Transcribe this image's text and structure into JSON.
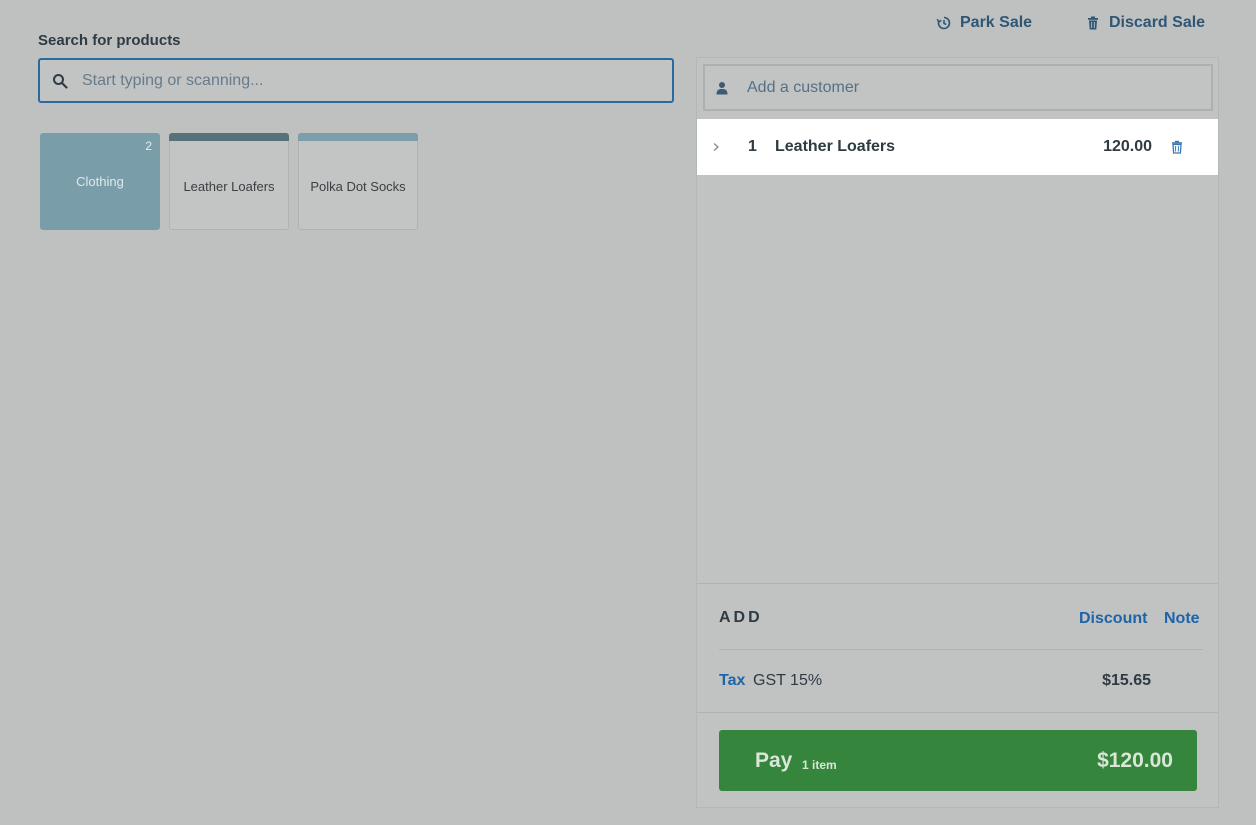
{
  "header": {
    "park_sale": "Park Sale",
    "discard_sale": "Discard Sale"
  },
  "search": {
    "label": "Search for products",
    "placeholder": "Start typing or scanning..."
  },
  "tiles": [
    {
      "label": "Clothing",
      "badge": "2",
      "type": "category",
      "color": "#7a9ea9"
    },
    {
      "label": "Leather Loafers",
      "type": "product",
      "stripe_color": "#577279"
    },
    {
      "label": "Polka Dot Socks",
      "type": "product",
      "stripe_color": "#7c9eaa"
    }
  ],
  "customer": {
    "placeholder": "Add a customer"
  },
  "line_items": [
    {
      "qty": "1",
      "name": "Leather Loafers",
      "price": "120.00"
    }
  ],
  "add": {
    "label": "ADD",
    "discount": "Discount",
    "note": "Note"
  },
  "tax": {
    "label": "Tax",
    "name": "GST 15%",
    "amount": "$15.65"
  },
  "pay": {
    "label": "Pay",
    "count": "1 item",
    "total": "$120.00",
    "color": "#35853c"
  },
  "colors": {
    "accent": "#1e65a8",
    "header_link": "#2f5775"
  }
}
